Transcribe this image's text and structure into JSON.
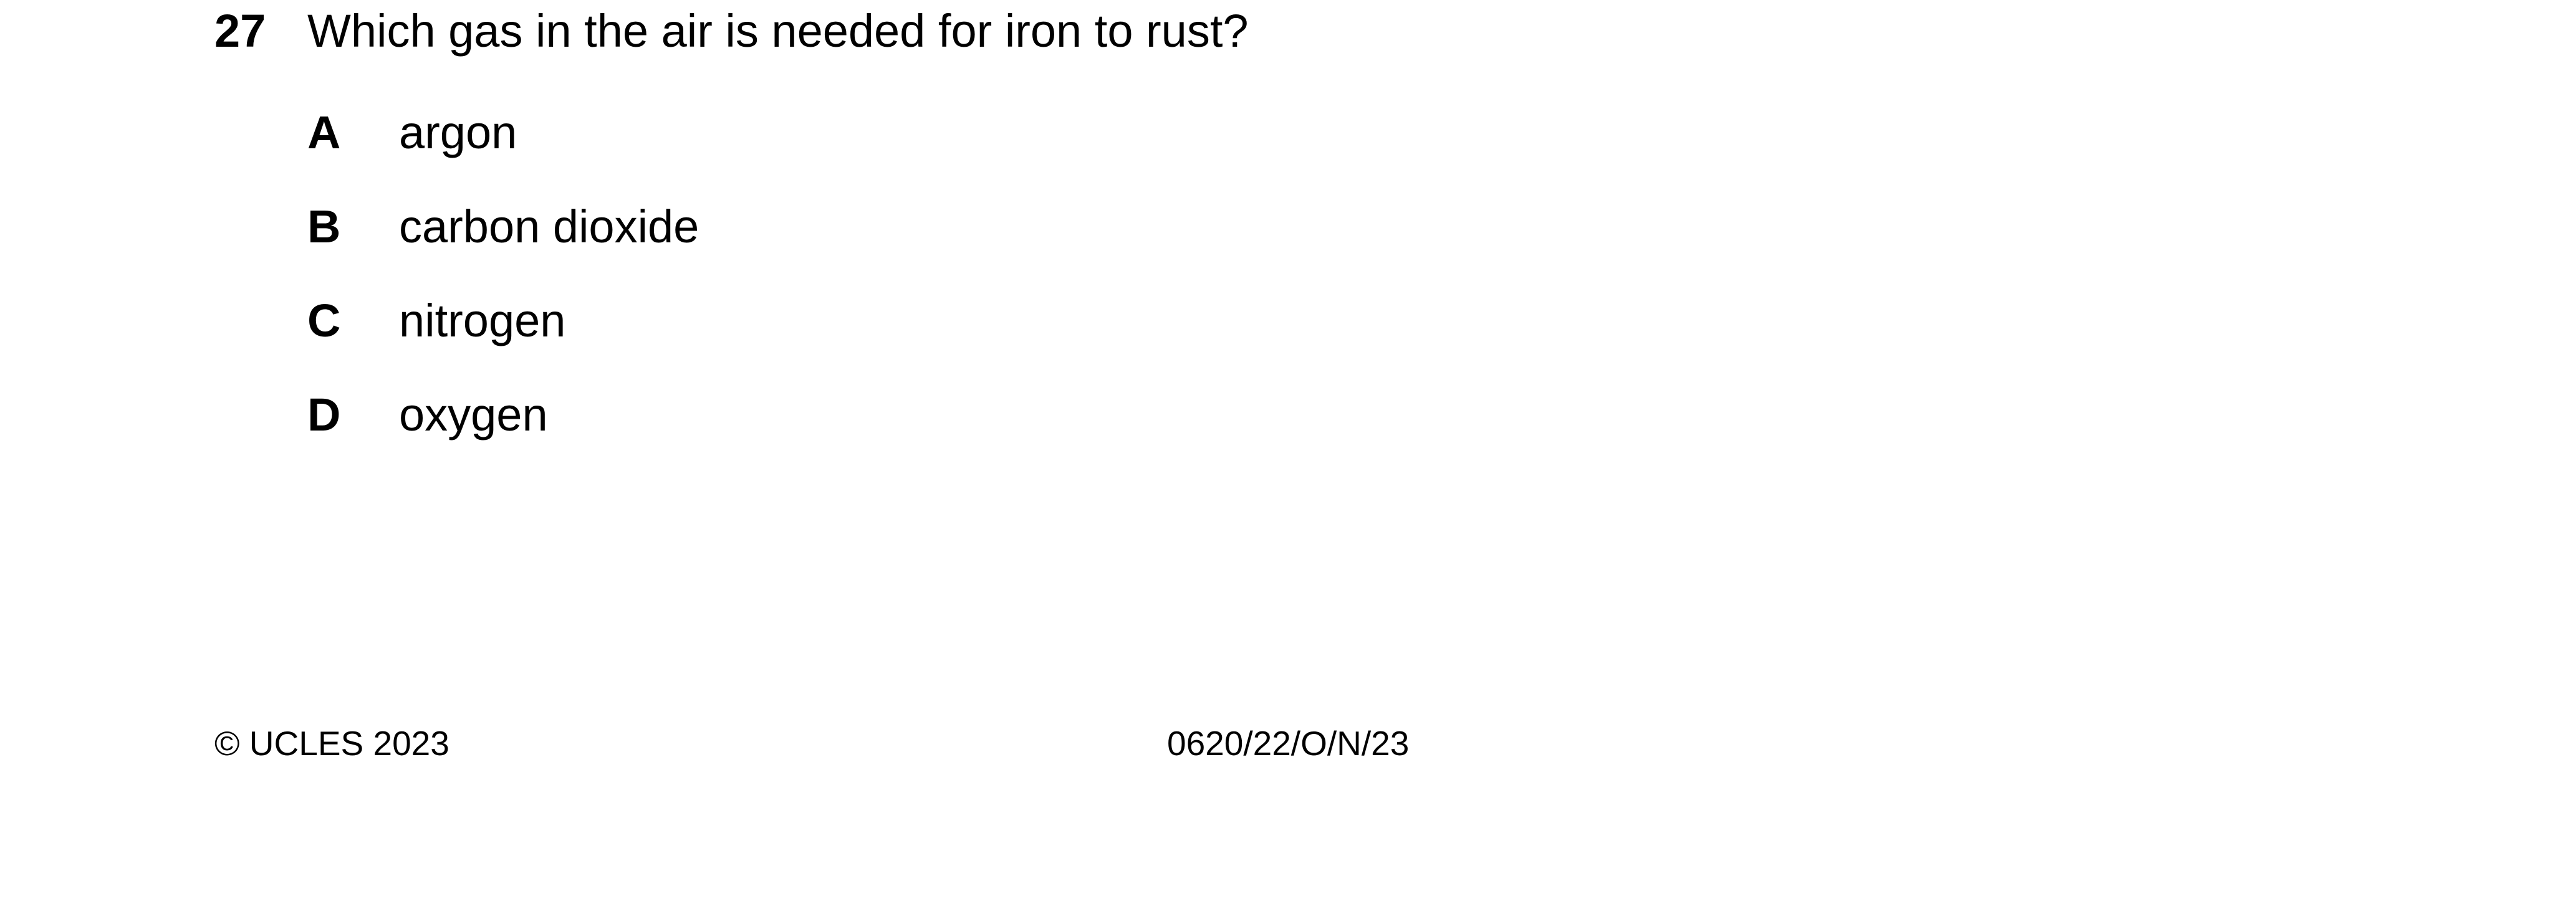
{
  "question": {
    "number": "27",
    "text": "Which gas in the air is needed for iron to rust?"
  },
  "options": [
    {
      "letter": "A",
      "text": "argon"
    },
    {
      "letter": "B",
      "text": "carbon dioxide"
    },
    {
      "letter": "C",
      "text": "nitrogen"
    },
    {
      "letter": "D",
      "text": "oxygen"
    }
  ],
  "footer": {
    "copyright": "© UCLES 2023",
    "paper_code": "0620/22/O/N/23"
  }
}
